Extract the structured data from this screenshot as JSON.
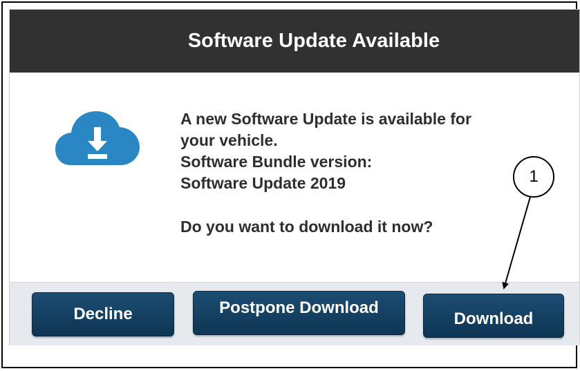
{
  "dialog": {
    "title": "Software Update Available",
    "icon": "cloud-download-icon",
    "message_lines": [
      "A new Software Update is available for",
      "your vehicle.",
      "Software Bundle version:",
      "Software Update 2019"
    ],
    "question": "Do you want to download it now?"
  },
  "buttons": {
    "decline": "Decline",
    "postpone": "Postpone Download",
    "download": "Download"
  },
  "callout": {
    "number": "1",
    "target": "download-button"
  },
  "colors": {
    "title_bar": "#313131",
    "button": "#163f60",
    "footer": "#e6e9ee",
    "icon": "#2a87c4"
  }
}
